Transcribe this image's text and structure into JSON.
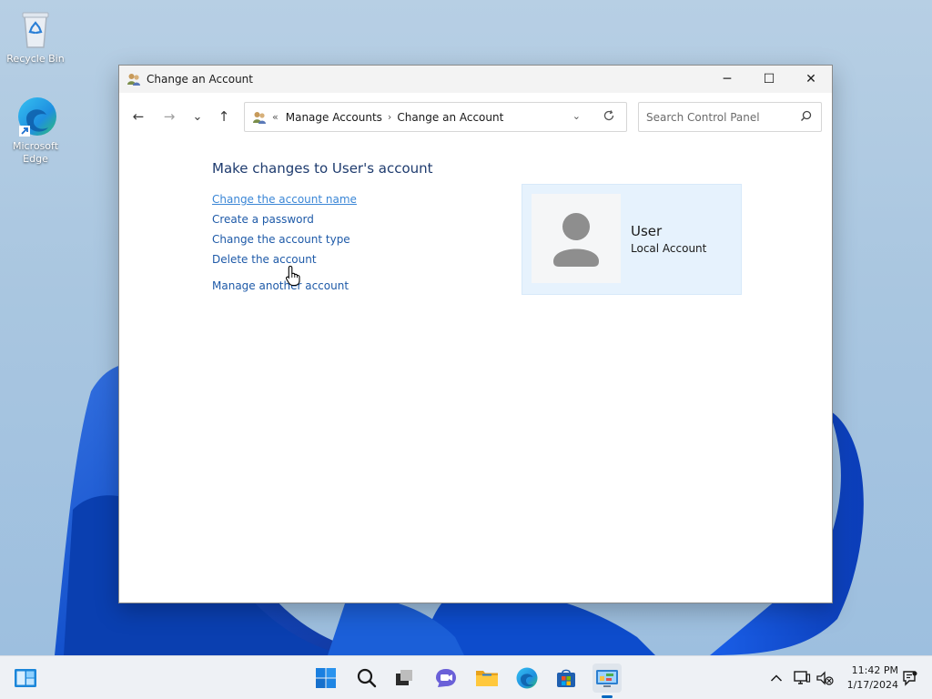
{
  "desktop": {
    "icons": [
      {
        "label": "Recycle Bin"
      },
      {
        "label": "Microsoft Edge"
      }
    ]
  },
  "window": {
    "title": "Change an Account",
    "controls": {
      "minimize": "─",
      "maximize": "☐",
      "close": "✕"
    }
  },
  "navbar": {
    "back": "←",
    "forward": "→",
    "recent": "⌄",
    "up": "↑",
    "breadcrumb": {
      "overflow": "«",
      "items": [
        "Manage Accounts",
        "Change an Account"
      ],
      "separator": "›"
    },
    "search": {
      "placeholder": "Search Control Panel"
    }
  },
  "content": {
    "heading": "Make changes to User's account",
    "tasks": [
      "Change the account name",
      "Create a password",
      "Change the account type",
      "Delete the account"
    ],
    "other_link": "Manage another account",
    "account": {
      "name": "User",
      "type": "Local Account"
    }
  },
  "taskbar": {
    "clock": {
      "time": "11:42 PM",
      "date": "1/17/2024"
    },
    "tray_chevron": "^"
  },
  "colors": {
    "link": "#1e5aa8",
    "link_hover": "#3a86d6",
    "heading": "#1e3b6e",
    "tile": "#e6f2fd",
    "accent": "#0067c0"
  }
}
